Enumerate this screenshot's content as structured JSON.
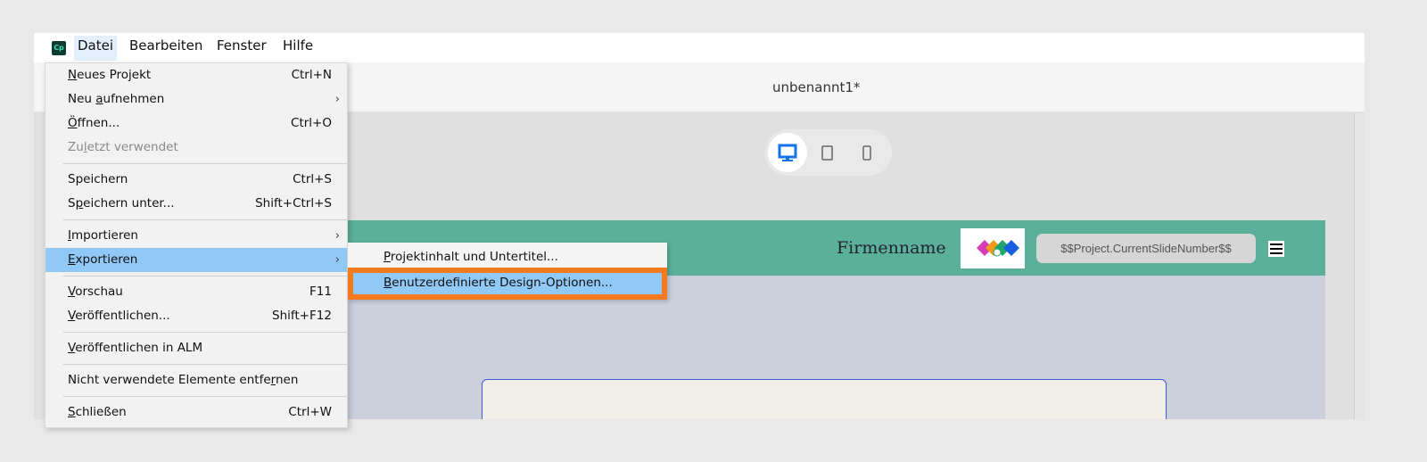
{
  "menubar": {
    "app_icon": "Cp",
    "items": [
      "Datei",
      "Bearbeiten",
      "Fenster",
      "Hilfe"
    ]
  },
  "document_title": "unbenannt1*",
  "device_toggle": {
    "selected": "desktop",
    "options": [
      "desktop-icon",
      "tablet-icon",
      "phone-icon"
    ]
  },
  "slide": {
    "company_name": "Firmenname",
    "slide_number_var": "$$Project.CurrentSlideNumber$$",
    "banner_color": "#5bb09a"
  },
  "file_menu": [
    {
      "label": "Neues Projekt",
      "u": 0,
      "shortcut": "Ctrl+N"
    },
    {
      "label": "Neu aufnehmen",
      "u": 4,
      "submenu": true
    },
    {
      "label": "Öffnen...",
      "u": 0,
      "shortcut": "Ctrl+O"
    },
    {
      "label": "Zuletzt verwendet",
      "u": 2,
      "disabled": true
    },
    {
      "sep": true
    },
    {
      "label": "Speichern",
      "u": -1,
      "shortcut": "Ctrl+S"
    },
    {
      "label": "Speichern unter...",
      "u": 1,
      "shortcut": "Shift+Ctrl+S"
    },
    {
      "sep": true
    },
    {
      "label": "Importieren",
      "u": 0,
      "submenu": true
    },
    {
      "label": "Exportieren",
      "u": 0,
      "submenu": true,
      "highlighted": true
    },
    {
      "sep": true
    },
    {
      "label": "Vorschau",
      "u": 0,
      "shortcut": "F11"
    },
    {
      "label": "Veröffentlichen...",
      "u": 0,
      "shortcut": "Shift+F12"
    },
    {
      "sep": true
    },
    {
      "label": "Veröffentlichen in ALM",
      "u": 0
    },
    {
      "sep": true
    },
    {
      "label": "Nicht verwendete Elemente entfernen",
      "u": 31
    },
    {
      "sep": true
    },
    {
      "label": "Schließen",
      "u": 0,
      "shortcut": "Ctrl+W"
    }
  ],
  "export_submenu": [
    {
      "label": "Projektinhalt und Untertitel...",
      "u": 0
    },
    {
      "label": "Benutzerdefinierte Design-Optionen...",
      "u": 0,
      "highlighted": true
    }
  ],
  "colors": {
    "highlight": "#90c8f6",
    "focus_outline": "#f47a20",
    "accent": "#1473e6"
  }
}
